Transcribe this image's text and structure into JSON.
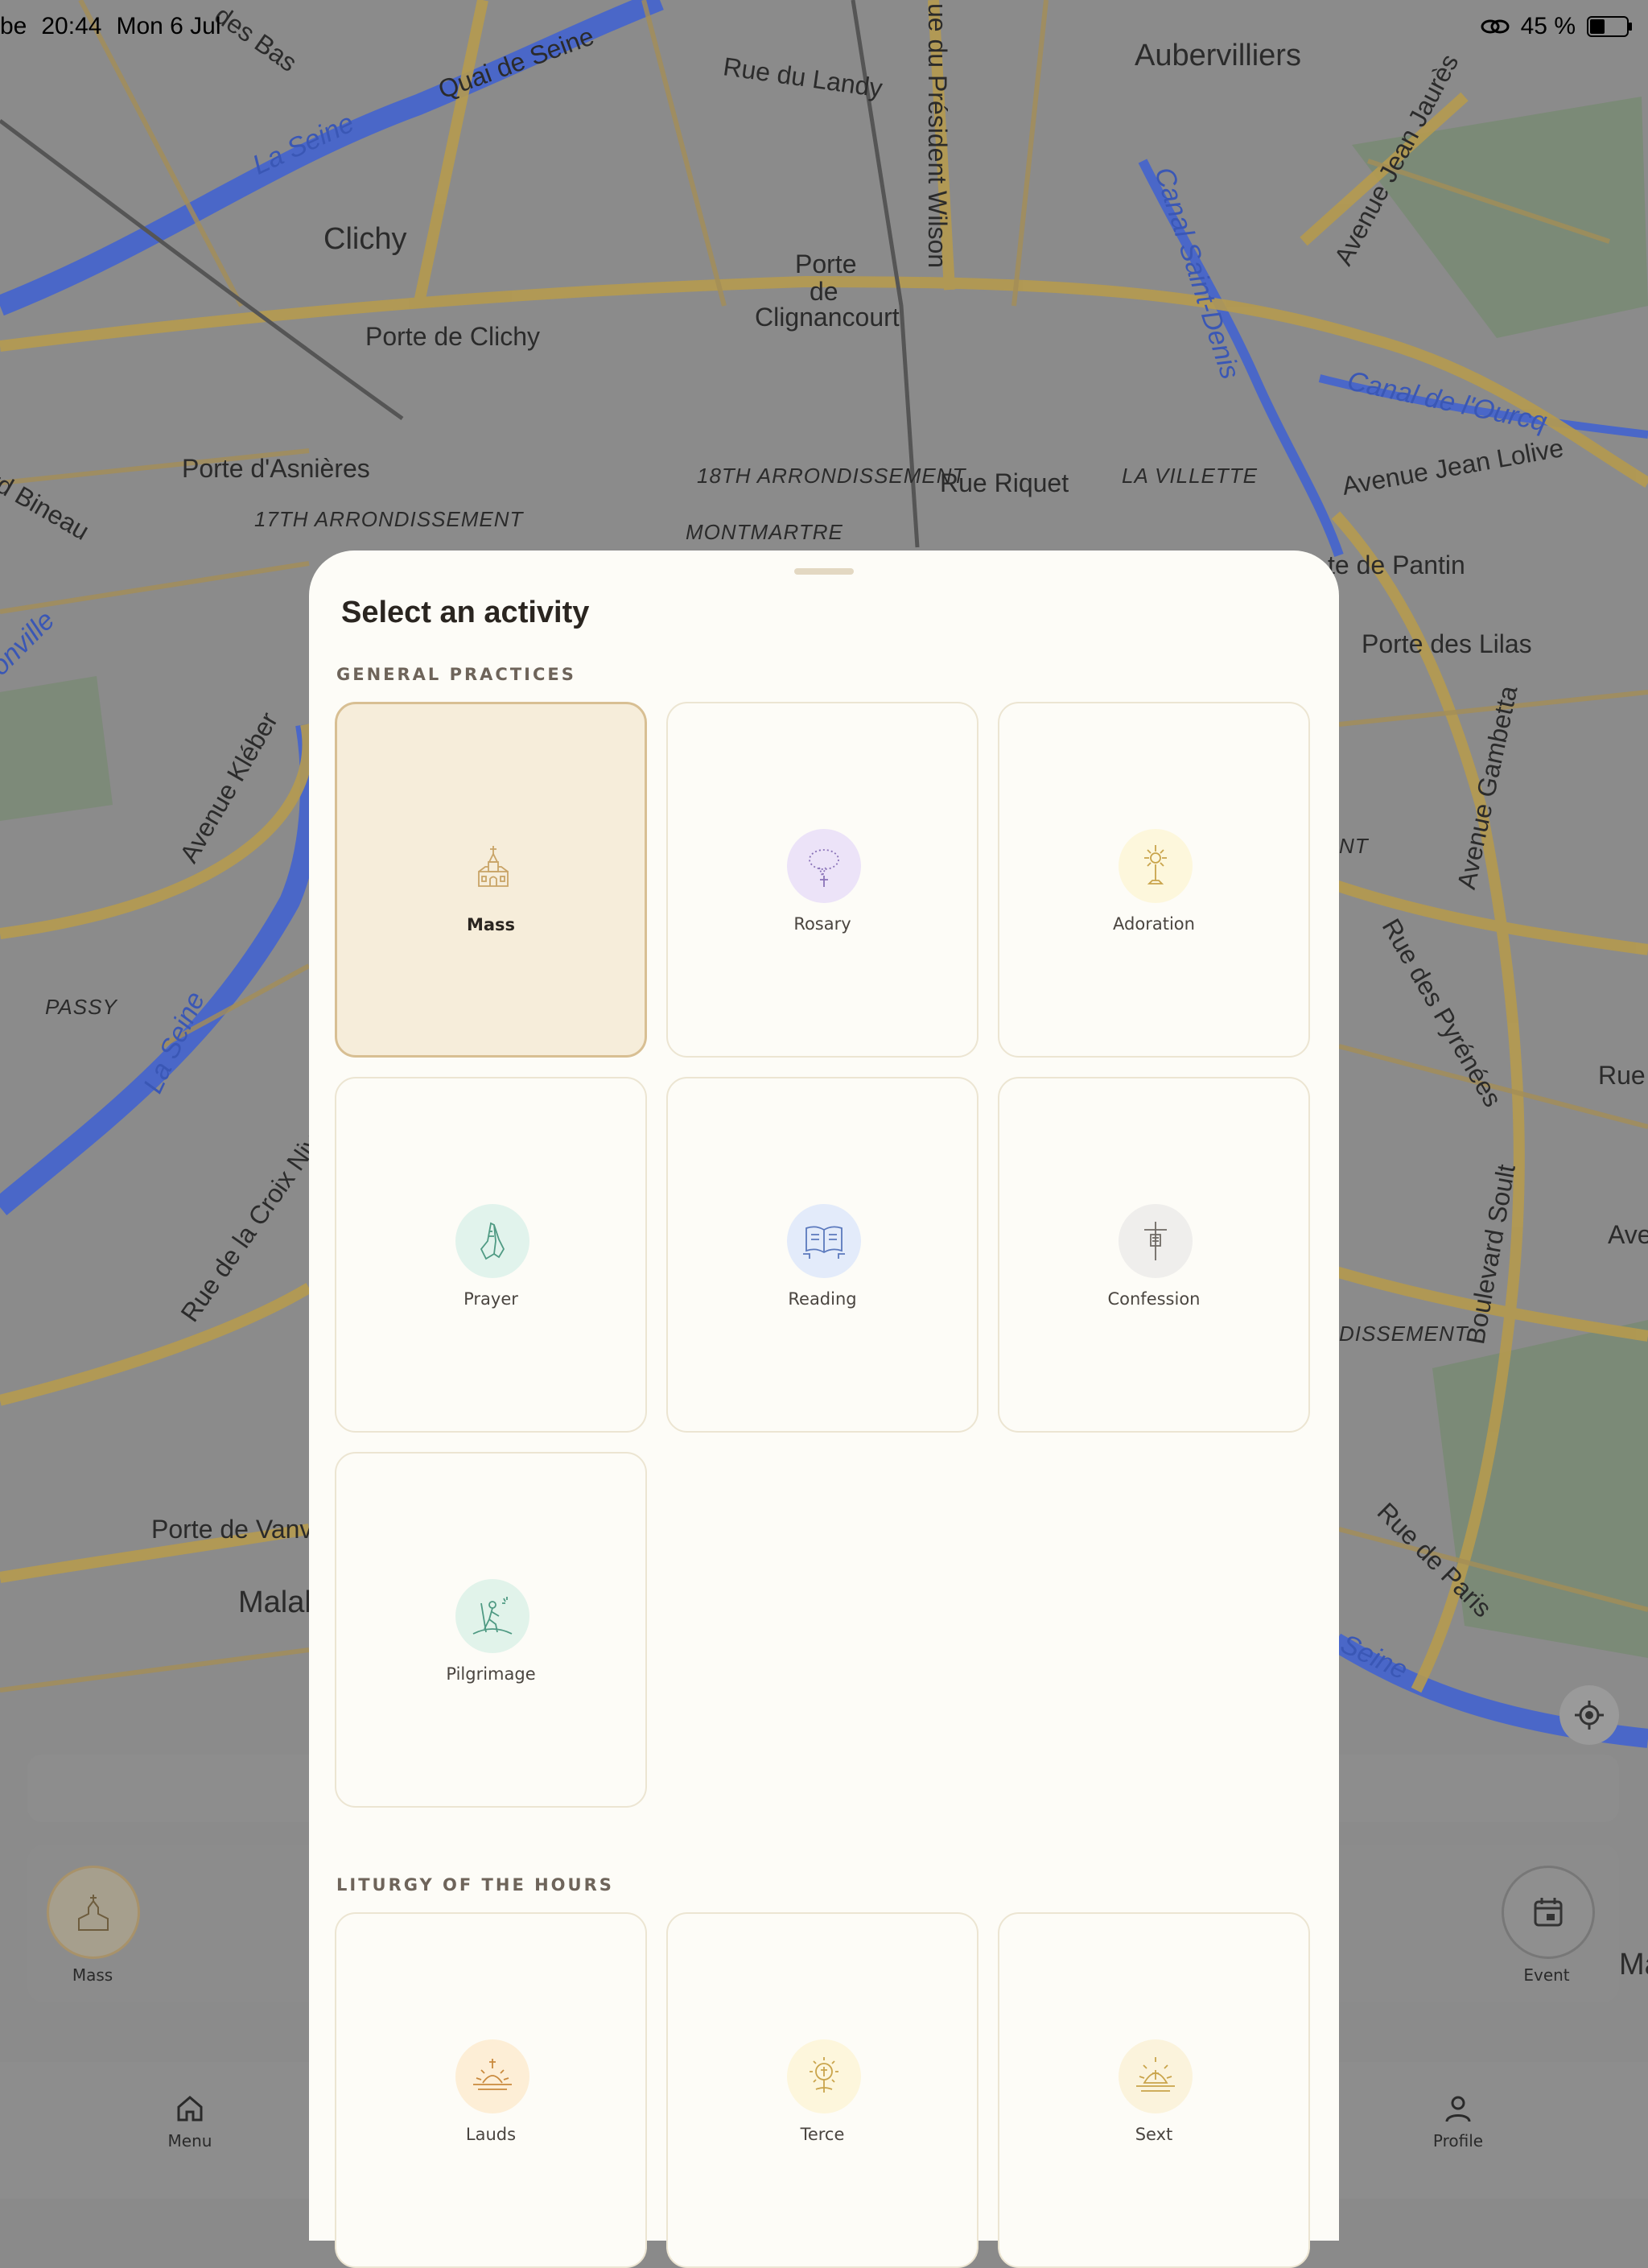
{
  "status_bar": {
    "carrier": "be",
    "time": "20:44",
    "date": "Mon 6 Jul",
    "battery": "45 %"
  },
  "map": {
    "labels": [
      {
        "text": "des Bas"
      },
      {
        "text": "Quai de Seine"
      },
      {
        "text": "Rue du Landy"
      },
      {
        "text": "ue du Président Wilson"
      },
      {
        "text": "Aubervilliers"
      },
      {
        "text": "Avenue Jean Jaurès"
      },
      {
        "text": "La Seine"
      },
      {
        "text": "Clichy"
      },
      {
        "text": "Porte"
      },
      {
        "text": "de"
      },
      {
        "text": "Clignancourt"
      },
      {
        "text": "Canal Saint-Denis"
      },
      {
        "text": "Porte de Clichy"
      },
      {
        "text": "Canal de l'Ourcq"
      },
      {
        "text": "Porte d'Asnières"
      },
      {
        "text": "18TH ARRONDISSEMENT"
      },
      {
        "text": "Rue Riquet"
      },
      {
        "text": "LA VILLETTE"
      },
      {
        "text": "Avenue Jean Lolive"
      },
      {
        "text": "rd Bineau"
      },
      {
        "text": "17TH ARRONDISSEMENT"
      },
      {
        "text": "MONTMARTRE"
      },
      {
        "text": "te de Pantin"
      },
      {
        "text": "onville"
      },
      {
        "text": "Porte des Lilas"
      },
      {
        "text": "Avenue Kléber"
      },
      {
        "text": "Avenue Gambetta"
      },
      {
        "text": "NT"
      },
      {
        "text": "PASSY"
      },
      {
        "text": "La Seine"
      },
      {
        "text": "Rue des Pyrénées"
      },
      {
        "text": "Rue"
      },
      {
        "text": "Rue de la Croix Nive"
      },
      {
        "text": "Boulevard Soult"
      },
      {
        "text": "Ave"
      },
      {
        "text": "DISSEMENT"
      },
      {
        "text": "Porte de Vanve"
      },
      {
        "text": "Rue de Paris"
      },
      {
        "text": "Malak"
      },
      {
        "text": "Seine"
      },
      {
        "text": "Ma"
      }
    ]
  },
  "under": {
    "mass_label": "Mass",
    "event_label": "Event",
    "tabs": {
      "menu": "Menu",
      "profile": "Profile"
    }
  },
  "sheet": {
    "title": "Select an activity",
    "sections": [
      {
        "title": "GENERAL PRACTICES",
        "items": [
          {
            "label": "Mass",
            "icon": "church-icon",
            "selected": true
          },
          {
            "label": "Rosary",
            "icon": "rosary-icon"
          },
          {
            "label": "Adoration",
            "icon": "monstrance-icon"
          },
          {
            "label": "Prayer",
            "icon": "praying-hands-icon"
          },
          {
            "label": "Reading",
            "icon": "open-book-icon"
          },
          {
            "label": "Confession",
            "icon": "confession-cross-icon"
          },
          {
            "label": "Pilgrimage",
            "icon": "pilgrim-icon"
          }
        ]
      },
      {
        "title": "LITURGY OF THE HOURS",
        "items": [
          {
            "label": "Lauds",
            "icon": "sunrise-cross-icon"
          },
          {
            "label": "Terce",
            "icon": "sun-cross-icon"
          },
          {
            "label": "Sext",
            "icon": "midday-sun-cross-icon"
          }
        ]
      }
    ]
  },
  "colors": {
    "sheet_bg": "#fdfcf7",
    "selected_bg": "#f6edda",
    "selected_border": "#d8bf93",
    "rosary_circle": "#ece3f8",
    "adoration_circle": "#fdf7dc",
    "prayer_circle": "#e1f3ec",
    "reading_circle": "#e3ebfa",
    "confession_circle": "#efeeec",
    "pilgrimage_circle": "#e1f3ea",
    "lauds_circle": "#fdeed6",
    "terce_circle": "#fdf6dc",
    "sext_circle": "#fbf3dc"
  }
}
